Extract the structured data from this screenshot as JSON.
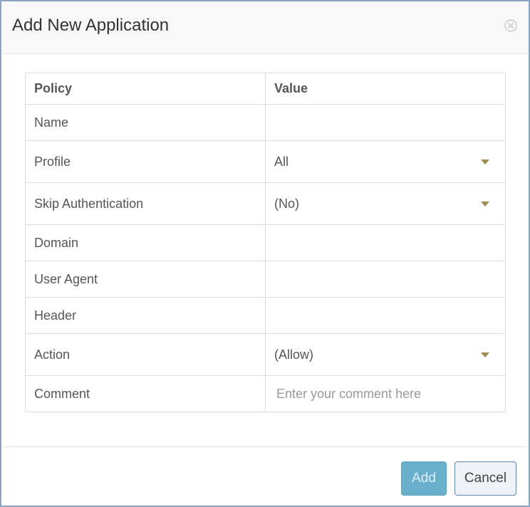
{
  "dialog": {
    "title": "Add New Application",
    "close_icon": "close-circle-icon"
  },
  "table": {
    "headers": {
      "policy": "Policy",
      "value": "Value"
    },
    "rows": {
      "name": {
        "label": "Name",
        "value": ""
      },
      "profile": {
        "label": "Profile",
        "value": "All"
      },
      "skip_auth": {
        "label": "Skip Authentication",
        "value": "(No)"
      },
      "domain": {
        "label": "Domain",
        "value": ""
      },
      "user_agent": {
        "label": "User Agent",
        "value": ""
      },
      "header": {
        "label": "Header",
        "value": ""
      },
      "action": {
        "label": "Action",
        "value": "(Allow)"
      },
      "comment": {
        "label": "Comment",
        "placeholder": "Enter your comment here"
      }
    }
  },
  "footer": {
    "add_label": "Add",
    "cancel_label": "Cancel"
  },
  "colors": {
    "caret": "#9e8c4e",
    "add_button": "#6ab0cc",
    "dialog_border": "#8aa4c4"
  }
}
